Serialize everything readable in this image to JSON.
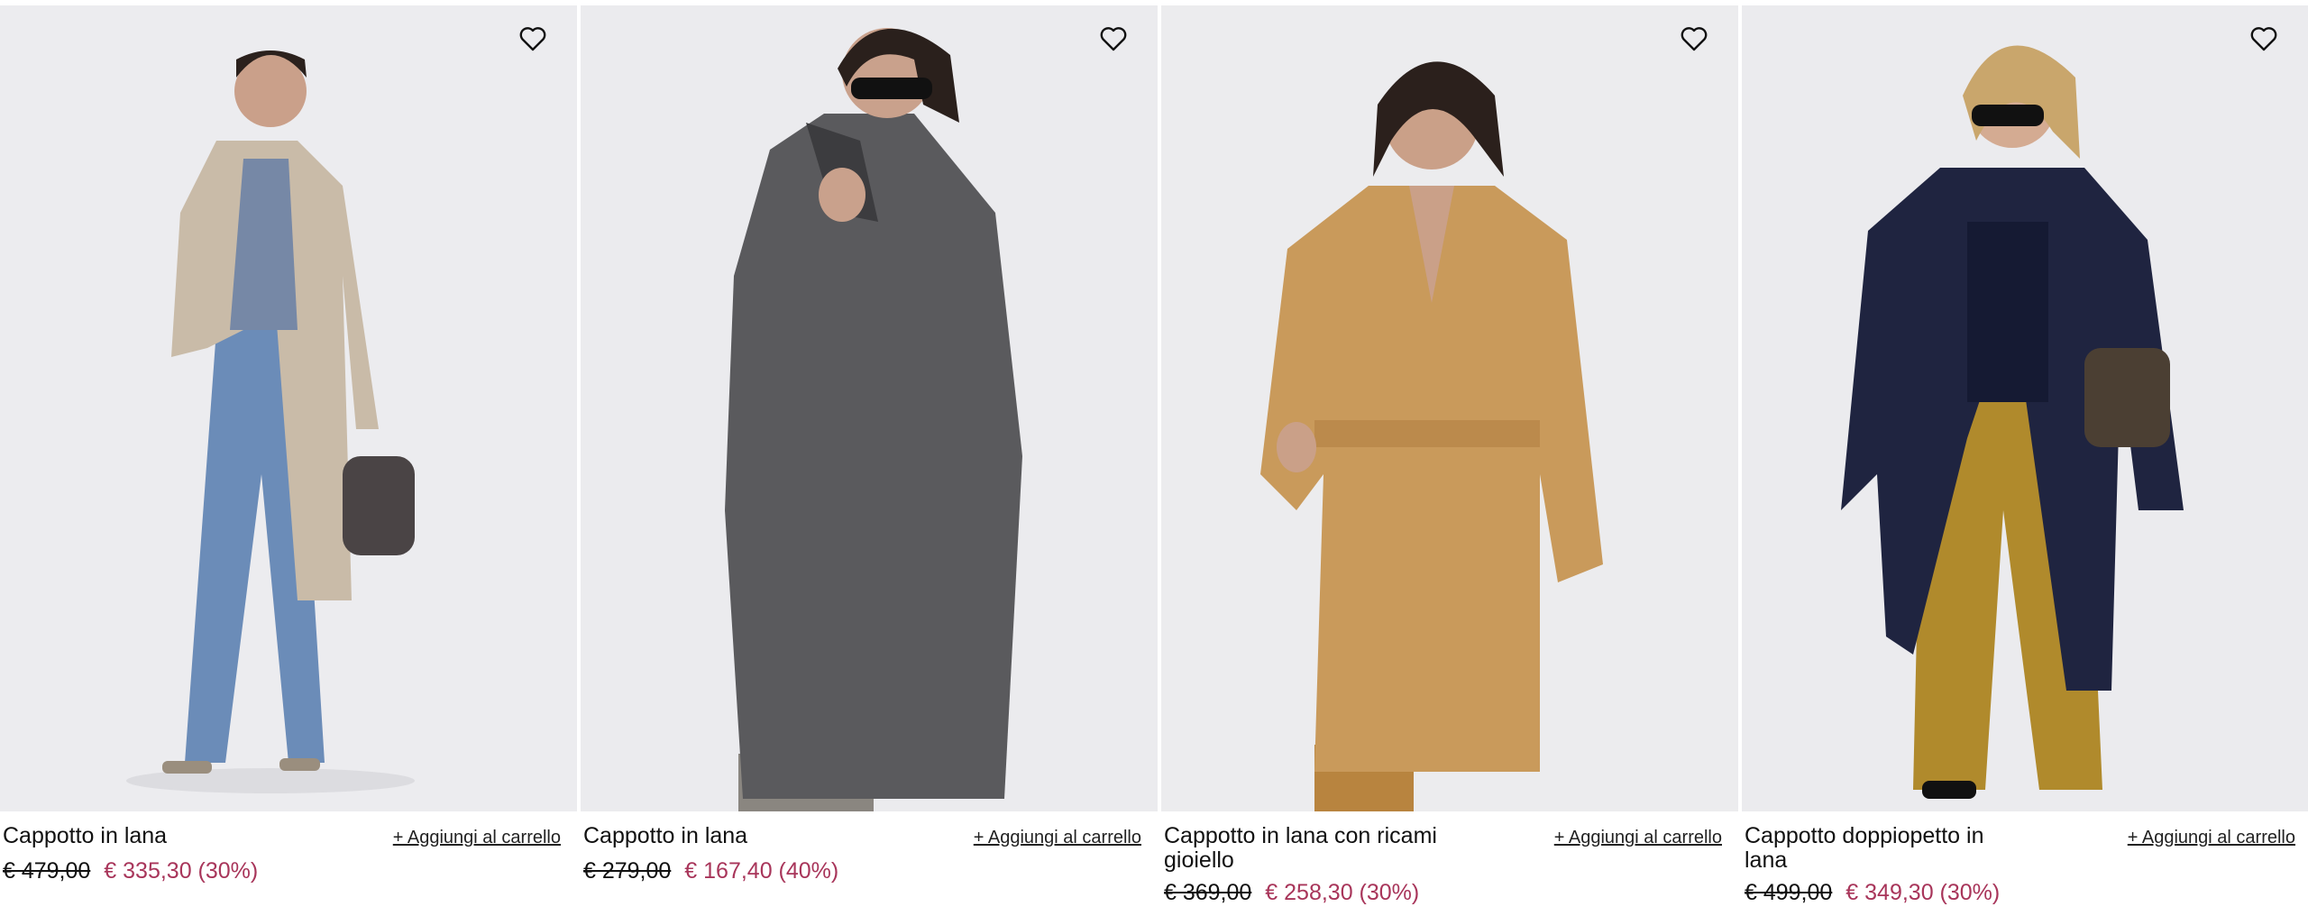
{
  "products": [
    {
      "title": "Cappotto in lana",
      "old_price": "€ 479,00",
      "new_price": "€ 335,30 (30%)",
      "add_to_cart": "+ Aggiungi al carrello",
      "favorite_icon": "heart-outline-icon"
    },
    {
      "title": "Cappotto in lana",
      "old_price": "€ 279,00",
      "new_price": "€ 167,40 (40%)",
      "add_to_cart": "+ Aggiungi al carrello",
      "favorite_icon": "heart-outline-icon"
    },
    {
      "title": "Cappotto in lana con ricami gioiello",
      "old_price": "€ 369,00",
      "new_price": "€ 258,30 (30%)",
      "add_to_cart": "+ Aggiungi al carrello",
      "favorite_icon": "heart-outline-icon"
    },
    {
      "title": "Cappotto doppiopetto in lana",
      "old_price": "€ 499,00",
      "new_price": "€ 349,30 (30%)",
      "add_to_cart": "+ Aggiungi al carrello",
      "favorite_icon": "heart-outline-icon"
    }
  ],
  "colors": {
    "sale_price": "#a8355a",
    "background": "#ffffff",
    "photo_backdrop": "#ebebee"
  }
}
